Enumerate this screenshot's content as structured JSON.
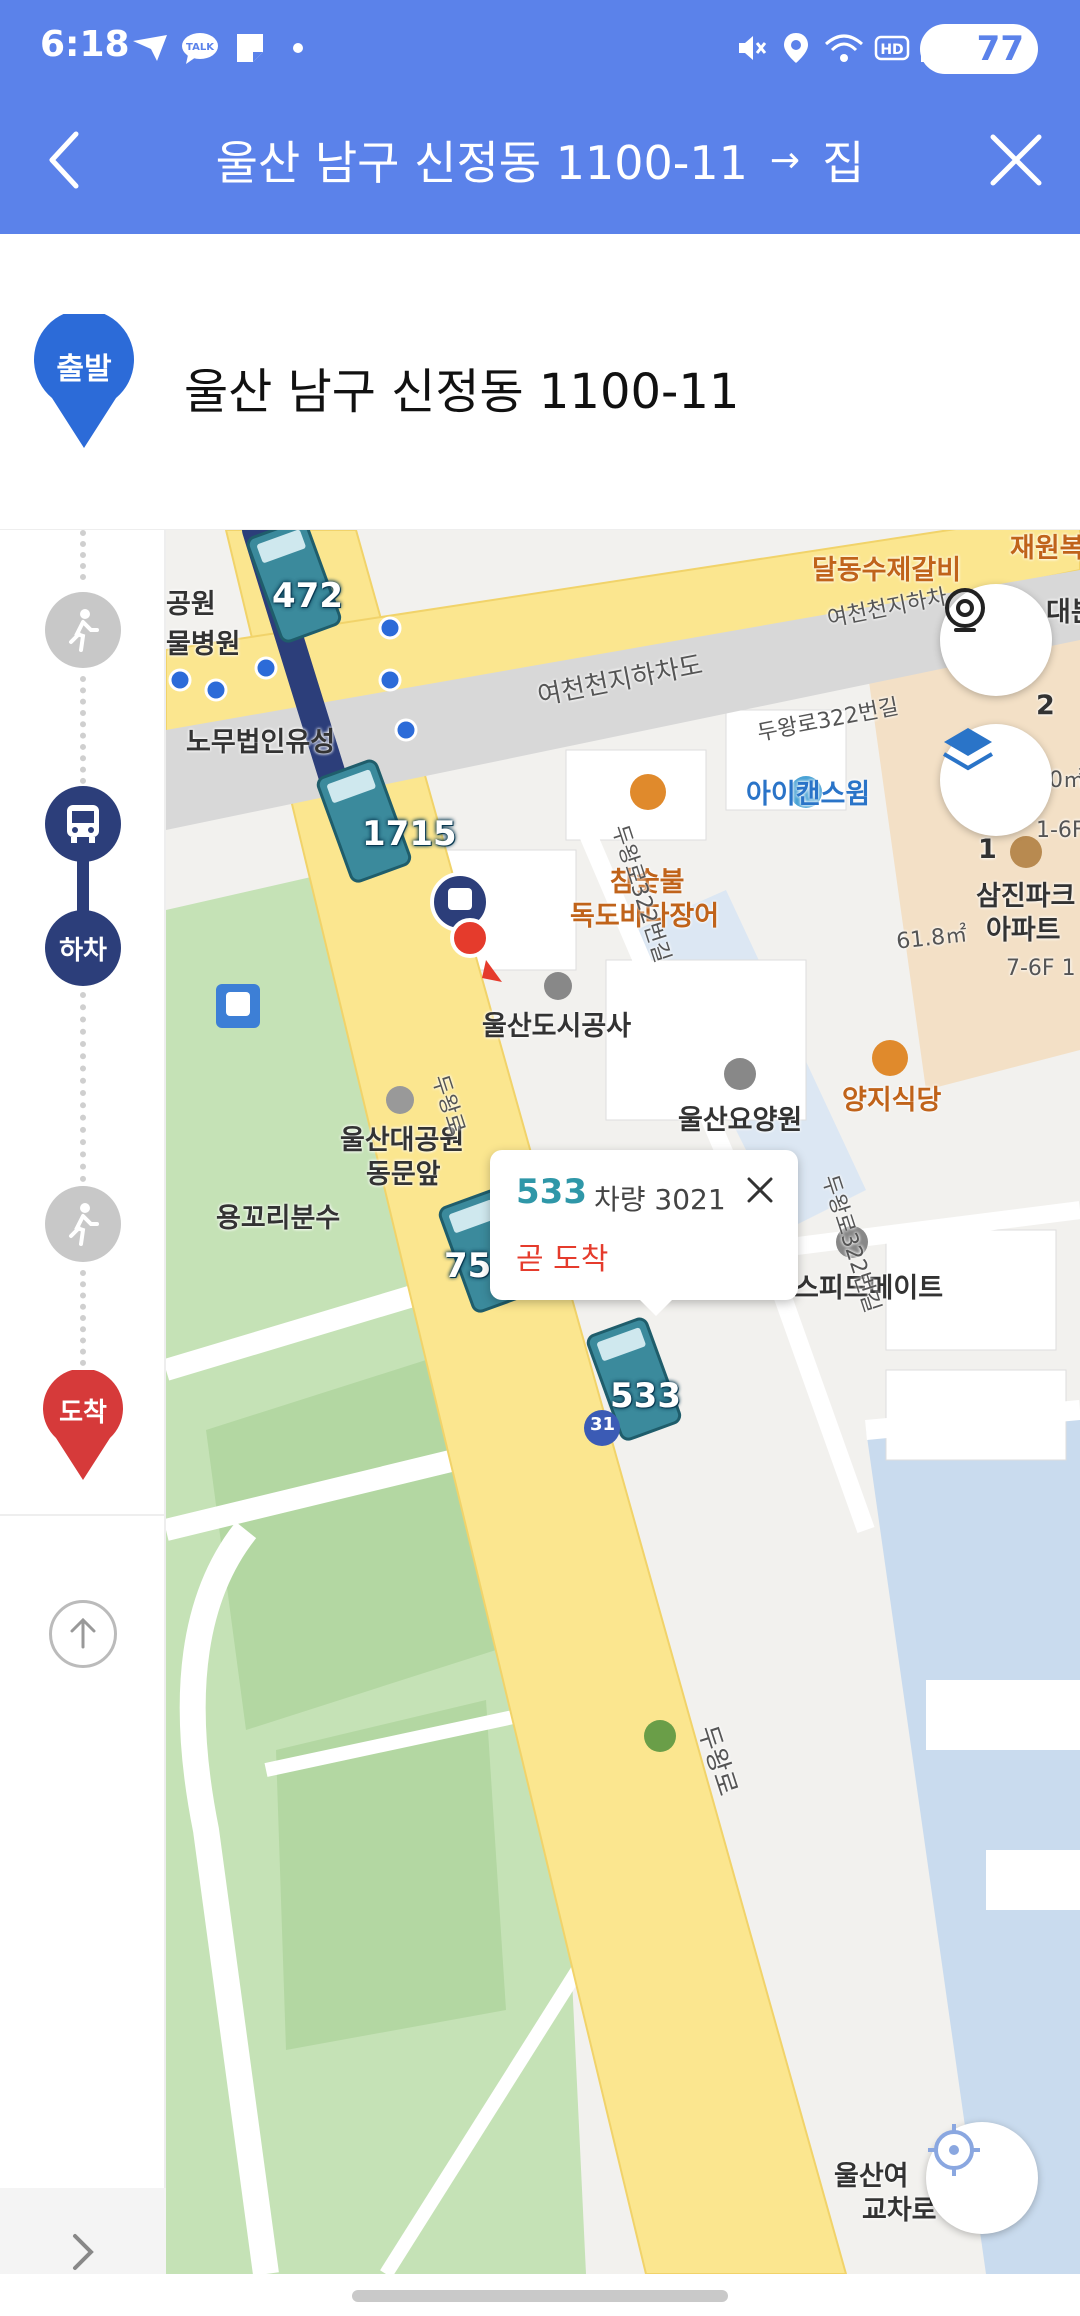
{
  "status_bar": {
    "time": "6:18",
    "battery": "77",
    "icons": [
      "kakao-navi-icon",
      "kakaotalk-icon",
      "notes-icon",
      "dot-icon",
      "mute-icon",
      "location-icon",
      "wifi-icon",
      "hd-icon",
      "signal-icon",
      "battery-icon"
    ]
  },
  "header": {
    "origin": "울산 남구 신정동 1100-11",
    "arrow": "→",
    "destination": "집"
  },
  "origin_row": {
    "badge": "출발",
    "address": "울산 남구 신정동 1100-11"
  },
  "timeline": {
    "start_label": "출발",
    "alight_label": "하차",
    "end_label": "도착"
  },
  "map": {
    "places": {
      "park_a": "공원",
      "hospital": "물병원",
      "law": "노무법인유성",
      "seafood": "달동수제갈비",
      "jaewon": "재원복",
      "daebun": "대분",
      "tunnel": "여천천지하차도",
      "stream_road": "여천천지하차",
      "duwang_322": "두왕로322번길",
      "icans": "아이캔스윔",
      "chamsutbul": "참숯불",
      "dokdo": "독도바다장어",
      "duwang_3222": "두왕로322번길",
      "urban_corp": "울산도시공사",
      "nursing": "울산요양원",
      "yangji": "양지식당",
      "samjin": "삼진파크",
      "apt": "아파트",
      "area_1": "61.8㎡",
      "area_2": "6.0㎡",
      "speedmate": "스피드메이트",
      "ulsan_park": "울산대공원",
      "east_gate": "동문앞",
      "yongkkori": "용꼬리분수",
      "duwangro": "두왕로",
      "duwangro2": "두왕로",
      "ulsan_inter_1": "울산여",
      "ulsan_inter_2": "교차로",
      "num_2": "2",
      "num_1": "1",
      "lot_a": "1-6F",
      "lot_b": "7-6F 1",
      "route_31": "31"
    },
    "buses": {
      "bus_472": "472",
      "bus_1715": "1715",
      "bus_75": "75",
      "bus_533": "533"
    }
  },
  "popup": {
    "route": "533",
    "vehicle": "차량 3021",
    "status": "곧 도착"
  },
  "colors": {
    "header": "#5b82ea",
    "bus_route": "#2c3e7a",
    "start_pin": "#2c6bd8",
    "end_pin": "#d63a3a",
    "arrival_text": "#e53b2c",
    "road": "#fbe68f",
    "bus_teal": "#3b8a9c"
  }
}
